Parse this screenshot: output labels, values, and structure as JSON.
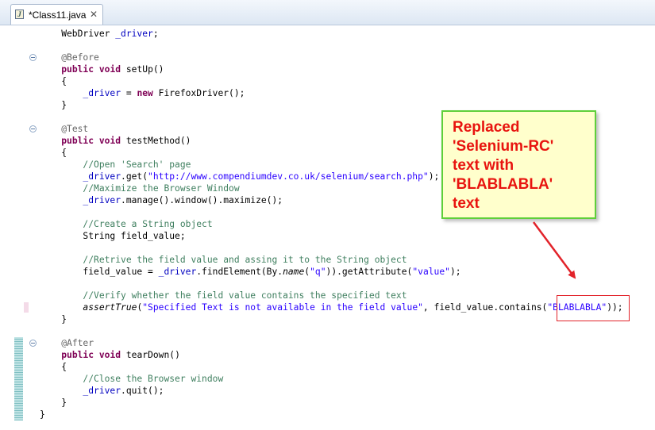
{
  "editor": {
    "tab": {
      "title": "*Class11.java",
      "icon": "java-file-icon",
      "close": "✕"
    },
    "lines": [
      [
        {
          "t": "    WebDriver "
        },
        {
          "t": "_driver",
          "c": "fld"
        },
        {
          "t": ";"
        }
      ],
      [],
      [
        {
          "t": "    "
        },
        {
          "t": "@Before",
          "c": "an"
        }
      ],
      [
        {
          "t": "    "
        },
        {
          "t": "public",
          "c": "kw"
        },
        {
          "t": " "
        },
        {
          "t": "void",
          "c": "kw"
        },
        {
          "t": " setUp()"
        }
      ],
      [
        {
          "t": "    {"
        }
      ],
      [
        {
          "t": "        "
        },
        {
          "t": "_driver",
          "c": "fld"
        },
        {
          "t": " = "
        },
        {
          "t": "new",
          "c": "kw"
        },
        {
          "t": " FirefoxDriver();"
        }
      ],
      [
        {
          "t": "    }"
        }
      ],
      [],
      [
        {
          "t": "    "
        },
        {
          "t": "@Test",
          "c": "an"
        }
      ],
      [
        {
          "t": "    "
        },
        {
          "t": "public",
          "c": "kw"
        },
        {
          "t": " "
        },
        {
          "t": "void",
          "c": "kw"
        },
        {
          "t": " testMethod()"
        }
      ],
      [
        {
          "t": "    {"
        }
      ],
      [
        {
          "t": "        "
        },
        {
          "t": "//Open 'Search' page",
          "c": "cm"
        }
      ],
      [
        {
          "t": "        "
        },
        {
          "t": "_driver",
          "c": "fld"
        },
        {
          "t": ".get("
        },
        {
          "t": "\"http://www.compendiumdev.co.uk/selenium/search.php\"",
          "c": "str"
        },
        {
          "t": ");"
        }
      ],
      [
        {
          "t": "        "
        },
        {
          "t": "//Maximize the Browser Window",
          "c": "cm"
        }
      ],
      [
        {
          "t": "        "
        },
        {
          "t": "_driver",
          "c": "fld"
        },
        {
          "t": ".manage().window().maximize();"
        }
      ],
      [],
      [
        {
          "t": "        "
        },
        {
          "t": "//Create a String object",
          "c": "cm"
        }
      ],
      [
        {
          "t": "        String field_value;"
        }
      ],
      [],
      [
        {
          "t": "        "
        },
        {
          "t": "//Retrive the field value and assing it to the String object",
          "c": "cm"
        }
      ],
      [
        {
          "t": "        field_value = "
        },
        {
          "t": "_driver",
          "c": "fld"
        },
        {
          "t": ".findElement(By."
        },
        {
          "t": "name",
          "c": "it"
        },
        {
          "t": "("
        },
        {
          "t": "\"q\"",
          "c": "str"
        },
        {
          "t": ")).getAttribute("
        },
        {
          "t": "\"value\"",
          "c": "str"
        },
        {
          "t": ");"
        }
      ],
      [],
      [
        {
          "t": "        "
        },
        {
          "t": "//Verify whether the field value contains the specified text",
          "c": "cm"
        }
      ],
      [
        {
          "t": "        "
        },
        {
          "t": "assertTrue",
          "c": "it"
        },
        {
          "t": "("
        },
        {
          "t": "\"Specified Text is not available in the field value\"",
          "c": "str"
        },
        {
          "t": ", field_value.contains("
        },
        {
          "t": "\"BLABLABLA\"",
          "c": "str"
        },
        {
          "t": "));"
        }
      ],
      [
        {
          "t": "    }"
        }
      ],
      [],
      [
        {
          "t": "    "
        },
        {
          "t": "@After",
          "c": "an"
        }
      ],
      [
        {
          "t": "    "
        },
        {
          "t": "public",
          "c": "kw"
        },
        {
          "t": " "
        },
        {
          "t": "void",
          "c": "kw"
        },
        {
          "t": " tearDown()"
        }
      ],
      [
        {
          "t": "    {"
        }
      ],
      [
        {
          "t": "        "
        },
        {
          "t": "//Close the Browser window",
          "c": "cm"
        }
      ],
      [
        {
          "t": "        "
        },
        {
          "t": "_driver",
          "c": "fld"
        },
        {
          "t": ".quit();"
        }
      ],
      [
        {
          "t": "    }"
        }
      ],
      [
        {
          "t": "}"
        }
      ]
    ],
    "colors": {
      "keyword": "#7f0055",
      "annotation": "#646464",
      "field": "#0000c0",
      "comment": "#3f7f5f",
      "string": "#2a00ff"
    }
  },
  "annotation": {
    "callout_lines": [
      "Replaced",
      "'Selenium-RC'",
      "text with",
      "'BLABLABLA'",
      "text"
    ],
    "text_color": "#e8140f",
    "border_color": "#5fcf3a",
    "background": "#ffffcc",
    "arrow_color": "#e2232a"
  }
}
